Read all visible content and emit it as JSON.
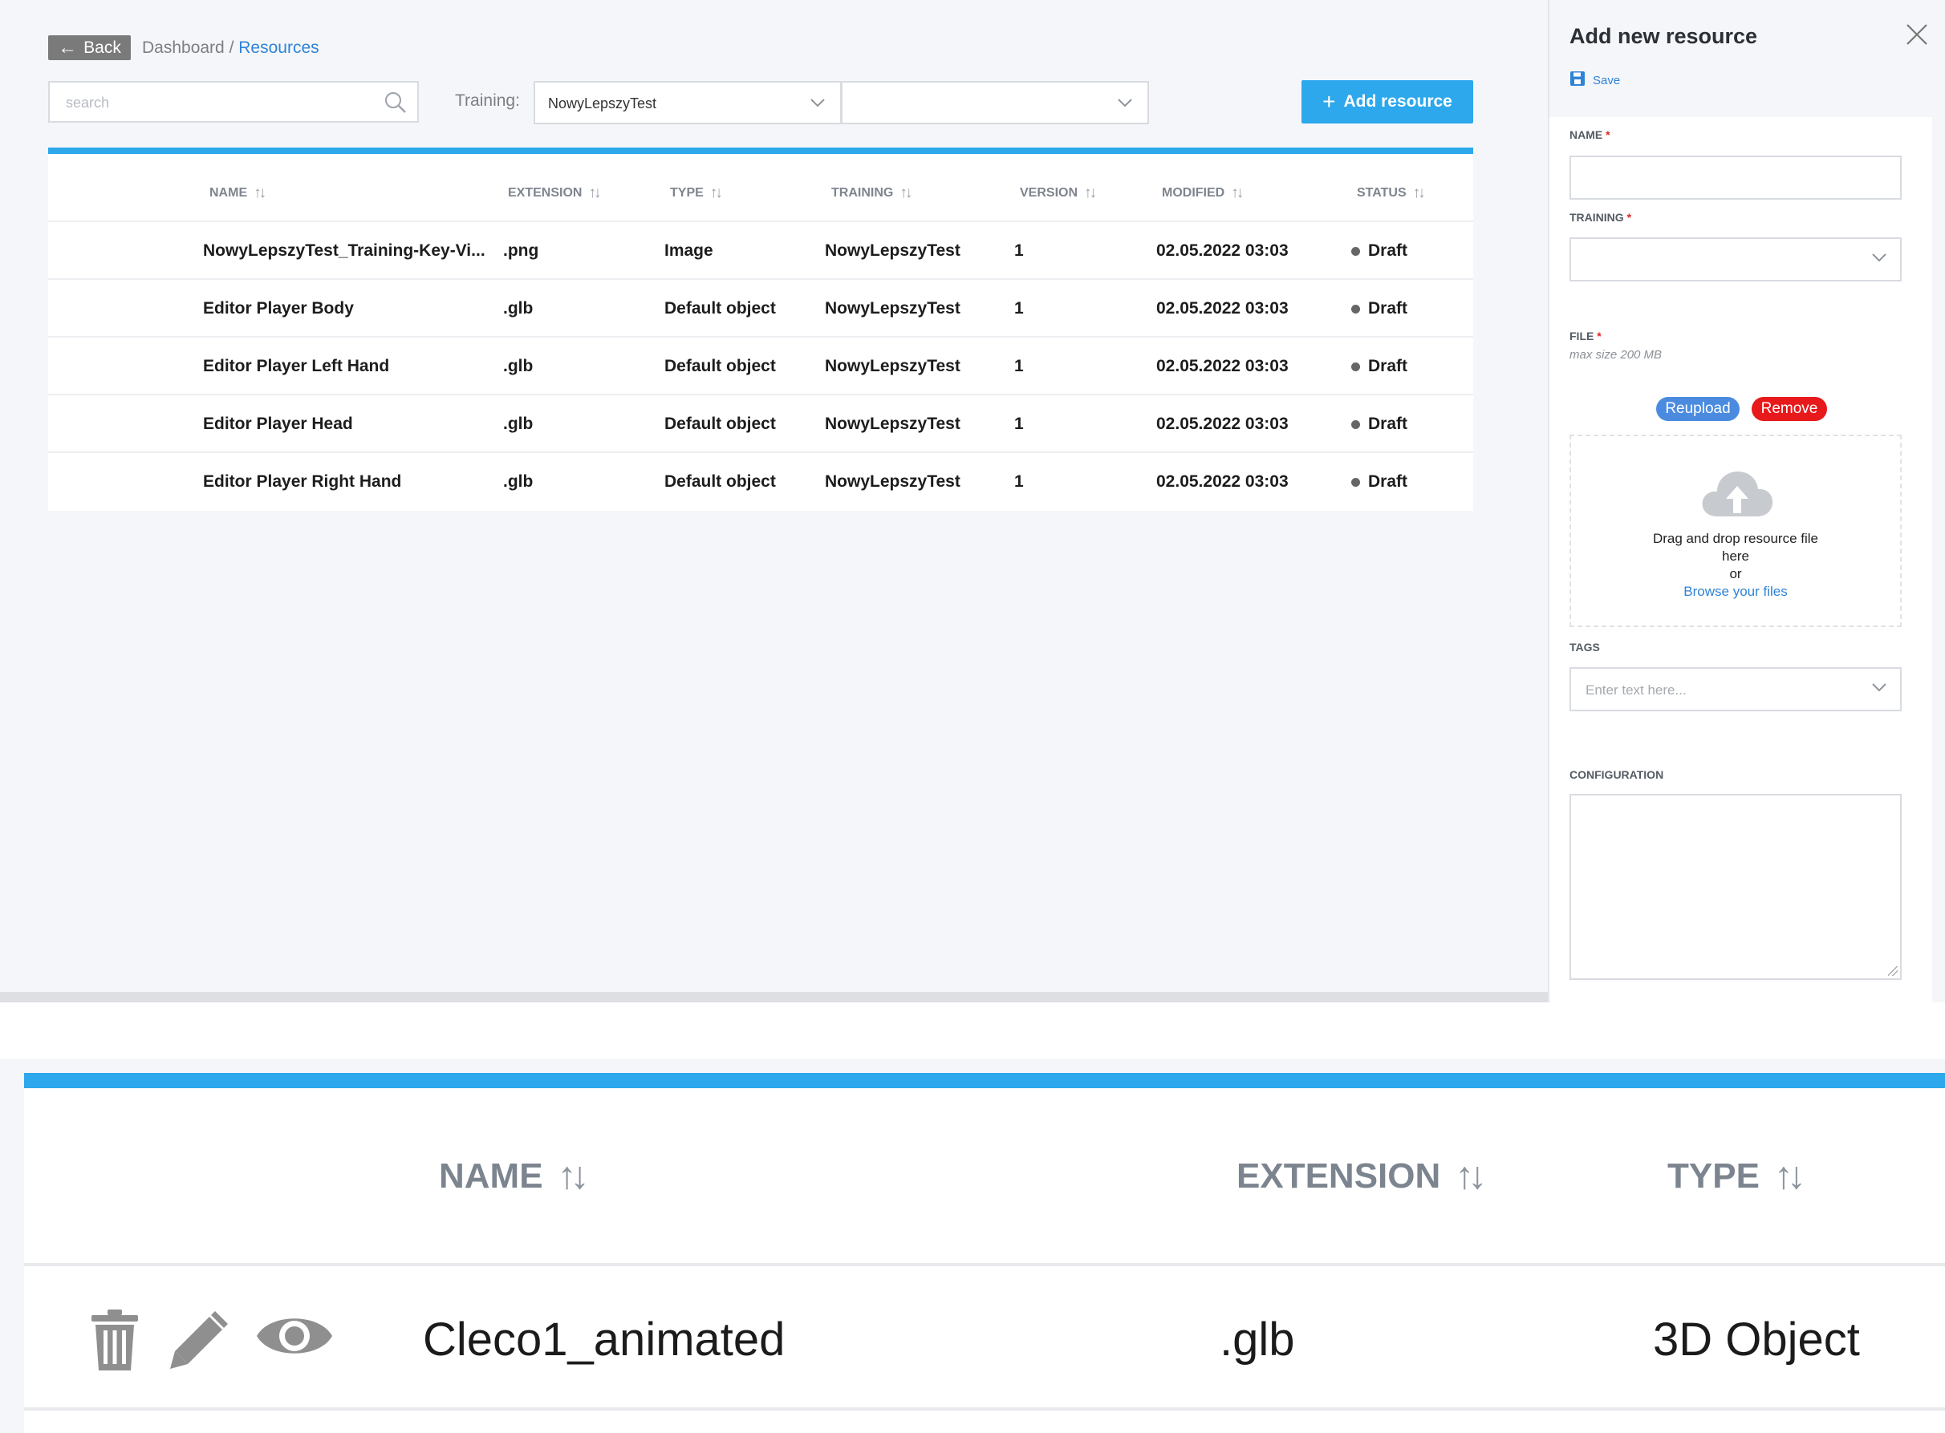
{
  "header": {
    "back_label": "Back",
    "breadcrumb_root": "Dashboard",
    "breadcrumb_sep": "/",
    "breadcrumb_current": "Resources"
  },
  "filters": {
    "search_placeholder": "search",
    "training_label": "Training:",
    "training_value": "NowyLepszyTest",
    "second_value": ""
  },
  "toolbar": {
    "add_label": "Add resource"
  },
  "table": {
    "columns": [
      "NAME",
      "EXTENSION",
      "TYPE",
      "TRAINING",
      "VERSION",
      "MODIFIED",
      "STATUS"
    ],
    "rows": [
      {
        "name": "NowyLepszyTest_Training-Key-Vi...",
        "extension": ".png",
        "type": "Image",
        "training": "NowyLepszyTest",
        "version": "1",
        "modified": "02.05.2022 03:03",
        "status": "Draft"
      },
      {
        "name": "Editor Player Body",
        "extension": ".glb",
        "type": "Default object",
        "training": "NowyLepszyTest",
        "version": "1",
        "modified": "02.05.2022 03:03",
        "status": "Draft"
      },
      {
        "name": "Editor Player Left Hand",
        "extension": ".glb",
        "type": "Default object",
        "training": "NowyLepszyTest",
        "version": "1",
        "modified": "02.05.2022 03:03",
        "status": "Draft"
      },
      {
        "name": "Editor Player Head",
        "extension": ".glb",
        "type": "Default object",
        "training": "NowyLepszyTest",
        "version": "1",
        "modified": "02.05.2022 03:03",
        "status": "Draft"
      },
      {
        "name": "Editor Player Right Hand",
        "extension": ".glb",
        "type": "Default object",
        "training": "NowyLepszyTest",
        "version": "1",
        "modified": "02.05.2022 03:03",
        "status": "Draft"
      }
    ]
  },
  "panel": {
    "title": "Add new resource",
    "save_label": "Save",
    "name_label": "NAME",
    "training_label": "TRAINING",
    "file_label": "FILE",
    "required_mark": "*",
    "file_hint": "max size 200 MB",
    "reupload_label": "Reupload",
    "remove_label": "Remove",
    "drop_line1": "Drag and drop resource file",
    "drop_line2": "here",
    "drop_or": "or",
    "drop_browse": "Browse your files",
    "tags_label": "TAGS",
    "tags_placeholder": "Enter text here...",
    "configuration_label": "CONFIGURATION"
  },
  "zoom": {
    "columns": [
      "NAME",
      "EXTENSION",
      "TYPE"
    ],
    "row": {
      "name": "Cleco1_animated",
      "extension": ".glb",
      "type": "3D Object"
    },
    "icons": [
      "trash-icon",
      "pencil-icon",
      "eye-icon"
    ]
  },
  "colors": {
    "accent": "#2da8ec",
    "link": "#2f83d6",
    "reupload": "#4a8be0",
    "remove": "#e8191b",
    "back": "#7a7a7a"
  }
}
